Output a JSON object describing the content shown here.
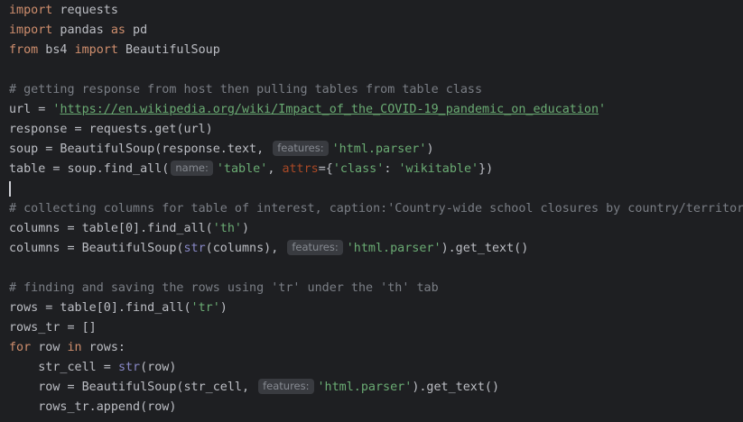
{
  "code": {
    "line1": {
      "kw": "import",
      "rest": " requests"
    },
    "line2": {
      "kw1": "import",
      "mid": " pandas ",
      "kw2": "as",
      "rest": " pd"
    },
    "line3": {
      "kw1": "from",
      "mid": " bs4 ",
      "kw2": "import",
      "rest": " BeautifulSoup"
    },
    "line5": {
      "comment": "# getting response from host then pulling tables from table class"
    },
    "line6": {
      "pre": "url = ",
      "q1": "'",
      "url": "https://en.wikipedia.org/wiki/Impact_of_the_COVID-19_pandemic_on_education",
      "q2": "'"
    },
    "line7": {
      "text": "response = requests.get(url)"
    },
    "line8": {
      "pre": "soup = BeautifulSoup(response.text, ",
      "hint": "features:",
      "str": "'html.parser'",
      "post": ")"
    },
    "line9": {
      "pre": "table = soup.find_all(",
      "hint": "name:",
      "str1": "'table'",
      "comma": ", ",
      "param": "attrs",
      "eq": "={",
      "str2": "'class'",
      "colon": ": ",
      "str3": "'wikitable'",
      "post": "})"
    },
    "line11": {
      "comment": "# collecting columns for table of interest, caption:'Country-wide school closures by country/territory'"
    },
    "line12": {
      "pre": "columns = table[0].find_all(",
      "str": "'th'",
      "post": ")"
    },
    "line13": {
      "pre": "columns = BeautifulSoup(",
      "bi": "str",
      "mid": "(columns), ",
      "hint": "features:",
      "str": "'html.parser'",
      "post": ").get_text()"
    },
    "line15": {
      "comment": "# finding and saving the rows using 'tr' under the 'th' tab"
    },
    "line16": {
      "pre": "rows = table[0].find_all(",
      "str": "'tr'",
      "post": ")"
    },
    "line17": {
      "text": "rows_tr = []"
    },
    "line18": {
      "kw1": "for",
      "mid": " row ",
      "kw2": "in",
      "rest": " rows:"
    },
    "line19": {
      "pre": "    str_cell = ",
      "bi": "str",
      "post": "(row)"
    },
    "line20": {
      "pre": "    row = BeautifulSoup(str_cell, ",
      "hint": "features:",
      "str": "'html.parser'",
      "post": ").get_text()"
    },
    "line21": {
      "text": "    rows_tr.append(row)"
    }
  },
  "colors": {
    "background": "#1e1f22",
    "keyword": "#cf8e6d",
    "string": "#6aab73",
    "comment": "#7a7e85",
    "builtin": "#8888c6",
    "parameter": "#aa4926",
    "default": "#bcbec4"
  }
}
